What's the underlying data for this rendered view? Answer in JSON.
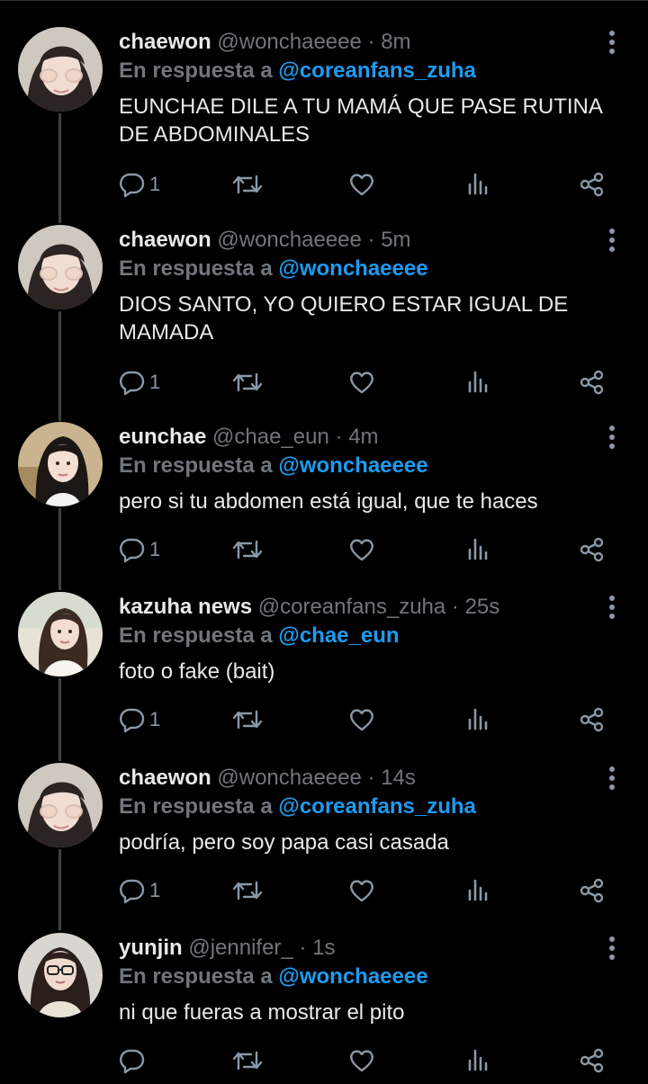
{
  "tweets": [
    {
      "name": "chaewon",
      "handle": "@wonchaeeee",
      "time": "8m",
      "reply_prefix": "En respuesta a",
      "reply_to": "@coreanfans_zuha",
      "text": "EUNCHAE DILE A TU MAMÁ QUE PASE RUTINA DE ABDOMINALES",
      "reply_count": "1",
      "avatar": "chaewon-avatar"
    },
    {
      "name": "chaewon",
      "handle": "@wonchaeeee",
      "time": "5m",
      "reply_prefix": "En respuesta a",
      "reply_to": "@wonchaeeee",
      "text": "DIOS SANTO, YO QUIERO ESTAR IGUAL DE MAMADA",
      "reply_count": "1",
      "avatar": "chaewon-avatar"
    },
    {
      "name": "eunchae",
      "handle": "@chae_eun",
      "time": "4m",
      "reply_prefix": "En respuesta a",
      "reply_to": "@wonchaeeee",
      "text": "pero si tu abdomen está igual, que te haces",
      "reply_count": "1",
      "avatar": "eunchae-avatar"
    },
    {
      "name": "kazuha news",
      "handle": "@coreanfans_zuha",
      "time": "25s",
      "reply_prefix": "En respuesta a",
      "reply_to": "@chae_eun",
      "text": "foto o fake (bait)",
      "reply_count": "1",
      "avatar": "kazuha-avatar"
    },
    {
      "name": "chaewon",
      "handle": "@wonchaeeee",
      "time": "14s",
      "reply_prefix": "En respuesta a",
      "reply_to": "@coreanfans_zuha",
      "text": "podría, pero soy papa casi casada",
      "reply_count": "1",
      "avatar": "chaewon-avatar"
    },
    {
      "name": "yunjin",
      "handle": "@jennifer_",
      "time": "1s",
      "reply_prefix": "En respuesta a",
      "reply_to": "@wonchaeeee",
      "text": "ni que fueras a mostrar el pito",
      "reply_count": "",
      "avatar": "yunjin-avatar"
    }
  ],
  "separator": "·",
  "icons": {
    "reply": "reply-icon",
    "retweet": "retweet-icon",
    "like": "heart-icon",
    "analytics": "analytics-icon",
    "share": "share-icon",
    "more": "more-vertical-icon"
  },
  "colors": {
    "background": "#000000",
    "text": "#e7e9ea",
    "muted": "#71767b",
    "mention": "#1d9bf0",
    "thread_line": "#3e4144",
    "icon": "#8b98a5"
  }
}
